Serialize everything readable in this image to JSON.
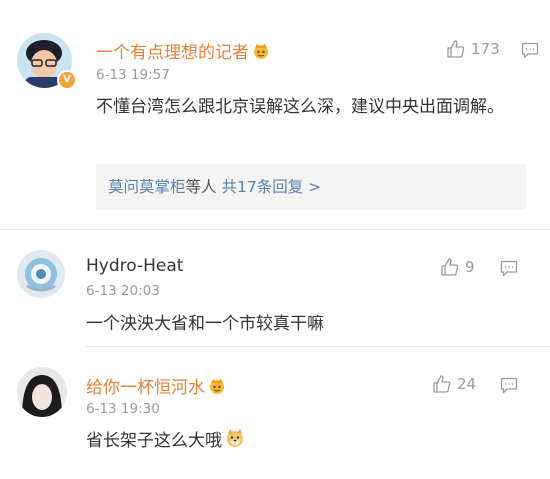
{
  "comments": [
    {
      "username": "一个有点理想的记者",
      "timestamp": "6-13 19:57",
      "text": "不懂台湾怎么跟北京误解这么深，建议中央出面调解。",
      "likes": "173",
      "name_color": "#e8803a"
    },
    {
      "username": "Hydro-Heat",
      "timestamp": "6-13 20:03",
      "text": "一个泱泱大省和一个市较真干嘛",
      "likes": "9"
    },
    {
      "username": "给你一杯恒河水",
      "timestamp": "6-13 19:30",
      "text": "省长架子这么大哦",
      "likes": "24",
      "name_color": "#e8803a"
    }
  ],
  "reply_summary": {
    "users": "莫问莫掌柜",
    "middle": "等人",
    "count": "共17条回复 >"
  },
  "icons": {
    "like": "thumbs-up-icon",
    "reply": "comment-bubble-icon",
    "vip": "crown-emoji-icon",
    "verified": "verified-v-icon",
    "doge": "doge-emoji-icon"
  }
}
